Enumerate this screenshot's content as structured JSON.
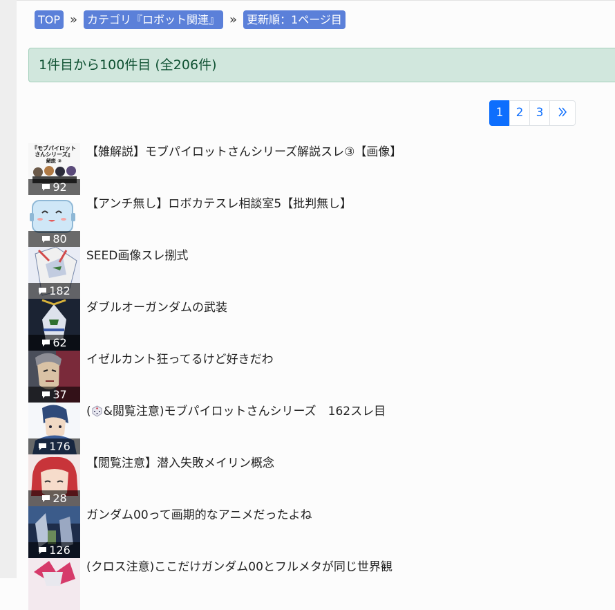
{
  "breadcrumb": {
    "top": "TOP",
    "sep": "»",
    "category": "カテゴリ『ロボット関連』",
    "sort": "更新順：1ページ目"
  },
  "summary": "1件目から100件目 (全206件)",
  "pagination": {
    "pages": [
      "1",
      "2",
      "3"
    ],
    "current": "1",
    "next": "»"
  },
  "threads": [
    {
      "title": "【雑解説】モブパイロットさんシリーズ解説スレ③【画像】",
      "count": "92",
      "thumb_text": "『モブパイロットさんシリーズ』解説 ③",
      "icon": "comment-icon"
    },
    {
      "title": "【アンチ無し】ロボカテスレ相談室5【批判無し】",
      "count": "80",
      "icon": "comment-icon"
    },
    {
      "title": "SEED画像スレ捌式",
      "count": "182",
      "icon": "comment-icon"
    },
    {
      "title": "ダブルオーガンダムの武装",
      "count": "62",
      "icon": "comment-icon"
    },
    {
      "title": "イゼルカント狂ってるけど好きだわ",
      "count": "37",
      "icon": "comment-icon"
    },
    {
      "title": "&閲覧注意)モブパイロットさんシリーズ　162スレ目",
      "title_prefix": "(",
      "count": "176",
      "icon": "comment-icon",
      "extra_icon": "dice-icon"
    },
    {
      "title": "【閲覧注意】潜入失敗メイリン概念",
      "count": "28",
      "icon": "comment-icon"
    },
    {
      "title": "ガンダム00って画期的なアニメだったよね",
      "count": "126",
      "icon": "comment-icon"
    },
    {
      "title": "(クロス注意)ここだけガンダム00とフルメタが同じ世界観",
      "count": "",
      "icon": "comment-icon"
    }
  ]
}
